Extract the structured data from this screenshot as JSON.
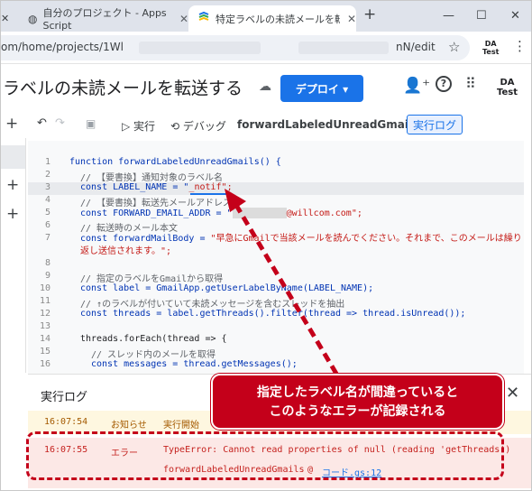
{
  "browser": {
    "tabs": [
      {
        "label": "自分のプロジェクト - Apps Script"
      },
      {
        "label": "特定ラベルの未読メールを転送する"
      }
    ],
    "url": "om/home/projects/1Wl",
    "url_tail": "nN/edit",
    "profile_label": "DA\nTest"
  },
  "header": {
    "project_title": "ラベルの未読メールを転送する",
    "deploy_label": "デプロイ ▾",
    "avatar_label": "DA\nTest"
  },
  "toolbar": {
    "run_label": "▷ 実行",
    "debug_label": "⟲ デバッグ",
    "function_select": "forwardLabeledUnreadGmails ▾",
    "log_label": "実行ログ"
  },
  "code": {
    "lines": [
      {
        "n": "1"
      },
      {
        "n": "2"
      },
      {
        "n": "3"
      },
      {
        "n": "4"
      },
      {
        "n": "5"
      },
      {
        "n": "6"
      },
      {
        "n": "7"
      },
      {
        "n": ""
      },
      {
        "n": "8"
      },
      {
        "n": "9"
      },
      {
        "n": "10"
      },
      {
        "n": "11"
      },
      {
        "n": "12"
      },
      {
        "n": "13"
      },
      {
        "n": "14"
      },
      {
        "n": "15"
      },
      {
        "n": "16"
      }
    ],
    "l1": "function forwardLabeledUnreadGmails() {",
    "l2": "// 【要書換】通知対象のラベル名",
    "l3a": "const LABEL_NAME = \"",
    "l3b": "_notif",
    "l3c": "\";",
    "l4": "// 【要書換】転送先メールアドレス",
    "l5a": "const FORWARD_EMAIL_ADDR = \"",
    "l5b": "@willcom.com\";",
    "l6": "// 転送時のメール本文",
    "l7a": "const forwardMailBody = ",
    "l7b": "\"早急にGmailで当該メールを読んでください。それまで、このメールは繰り返し送信されます。\";",
    "l9": "// 指定のラベルをGmailから取得",
    "l10": "const label = GmailApp.getUserLabelByName(LABEL_NAME);",
    "l11": "// ↑のラベルが付いていて未読メッセージを含むスレッドを抽出",
    "l12": "const threads = label.getThreads().filter(thread => thread.isUnread());",
    "l14": "threads.forEach(thread => {",
    "l15": "// スレッド内のメールを取得",
    "l16": "const messages = thread.getMessages();"
  },
  "log": {
    "title": "実行ログ",
    "rows": [
      {
        "time": "16:07:54",
        "level": "お知らせ",
        "message": "実行開始"
      },
      {
        "time": "16:07:55",
        "level": "エラー",
        "message": "TypeError: Cannot read properties of null (reading 'getThreads')",
        "location": "forwardLabeledUnreadGmails",
        "at": "@",
        "link": "コード.gs:12"
      }
    ]
  },
  "annotation": {
    "line1": "指定したラベル名が間違っていると",
    "line2": "このようなエラーが記録される"
  },
  "colors": {
    "accent": "#1a73e8",
    "annotation_red": "#c4001a",
    "error_bg": "#fce8e6",
    "notice_bg": "#fef7e0"
  }
}
